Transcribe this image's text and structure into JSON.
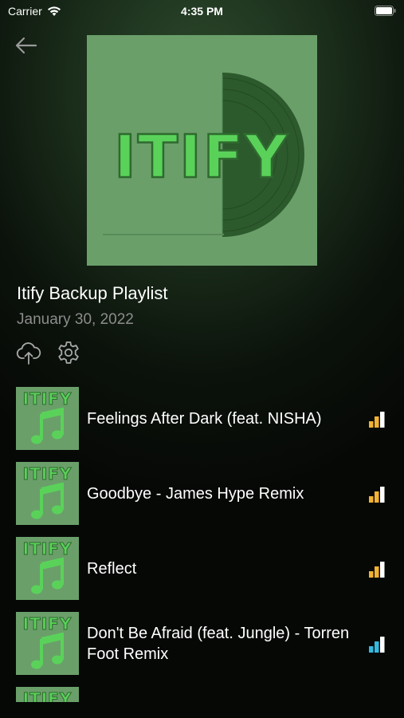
{
  "status": {
    "carrier": "Carrier",
    "time": "4:35 PM"
  },
  "cover": {
    "word": "ITIFY",
    "word_color": "#5ad25a",
    "bg_color": "#6a9f6a"
  },
  "playlist": {
    "title": "Itify Backup Playlist",
    "date": "January 30, 2022"
  },
  "icons": {
    "back": "back-arrow-icon",
    "upload": "cloud-upload-icon",
    "settings": "gear-icon",
    "note": "music-note-icon",
    "signal": "signal-bars-icon"
  },
  "tracks": [
    {
      "name": "Feelings After Dark (feat. NISHA)",
      "bar_color": "#f2b233"
    },
    {
      "name": "Goodbye - James Hype Remix",
      "bar_color": "#f2b233"
    },
    {
      "name": "Reflect",
      "bar_color": "#f2b233"
    },
    {
      "name": "Don't Be Afraid (feat. Jungle) - Torren Foot Remix",
      "bar_color": "#35b8e0"
    },
    {
      "name": "",
      "bar_color": "#f2b233"
    }
  ],
  "thumb_word": "ITIFY"
}
